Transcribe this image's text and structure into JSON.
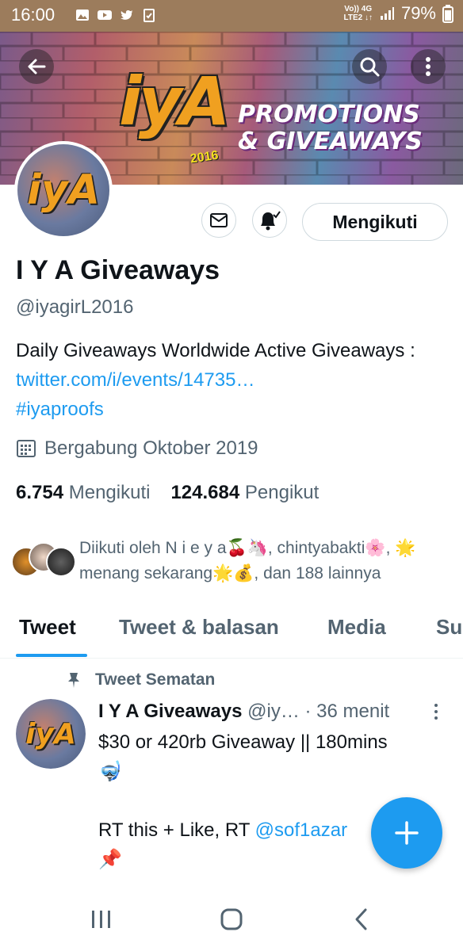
{
  "status_bar": {
    "time": "16:00",
    "network_top": "Vo)) 4G",
    "network_bottom": "LTE2 ↓↑",
    "battery": "79%",
    "icons": [
      "gallery-icon",
      "youtube-icon",
      "twitter-icon",
      "clipboard-check-icon",
      "signal-icon",
      "battery-icon"
    ]
  },
  "banner": {
    "logo_text": "iyA",
    "logo_year": "2016",
    "line1": "PROMOTIONS",
    "line2": "& GIVEAWAYS",
    "back_icon": "back-arrow-icon",
    "search_icon": "search-icon",
    "more_icon": "more-vertical-icon"
  },
  "profile": {
    "avatar_text": "iyA",
    "message_icon": "mail-icon",
    "notify_icon": "bell-check-icon",
    "follow_label": "Mengikuti",
    "name": "I Y A Giveaways",
    "handle": "@iyagirL2016",
    "bio_text": "Daily Giveaways Worldwide   Active Giveaways : ",
    "bio_link": "twitter.com/i/events/14735…",
    "bio_hashtag": "#iyaproofs",
    "joined": "Bergabung Oktober 2019",
    "following_count": "6.754",
    "following_label": "Mengikuti",
    "followers_count": "124.684",
    "followers_label": "Pengikut",
    "followed_by": "Diikuti oleh N i e y a🍒🦄, chintyabakti🌸, 🌟menang sekarang🌟💰, dan 188 lainnya"
  },
  "tabs": [
    {
      "label": "Tweet",
      "active": true
    },
    {
      "label": "Tweet & balasan",
      "active": false
    },
    {
      "label": "Media",
      "active": false
    },
    {
      "label": "Su",
      "active": false
    }
  ],
  "tweet": {
    "pinned_label": "Tweet Sematan",
    "name": "I Y A Giveaways",
    "handle": "@iy…",
    "separator": "·",
    "time": "36 menit",
    "line1": "$30 or 420rb Giveaway || 180mins",
    "line2": "🤿",
    "line3_text": "RT this + Like, RT ",
    "line3_mention": "@sof1azar",
    "line4": "📌"
  },
  "colors": {
    "accent": "#1d9bf0",
    "text": "#0f1419",
    "muted": "#536471",
    "status_bar": "#9c7c5c"
  }
}
